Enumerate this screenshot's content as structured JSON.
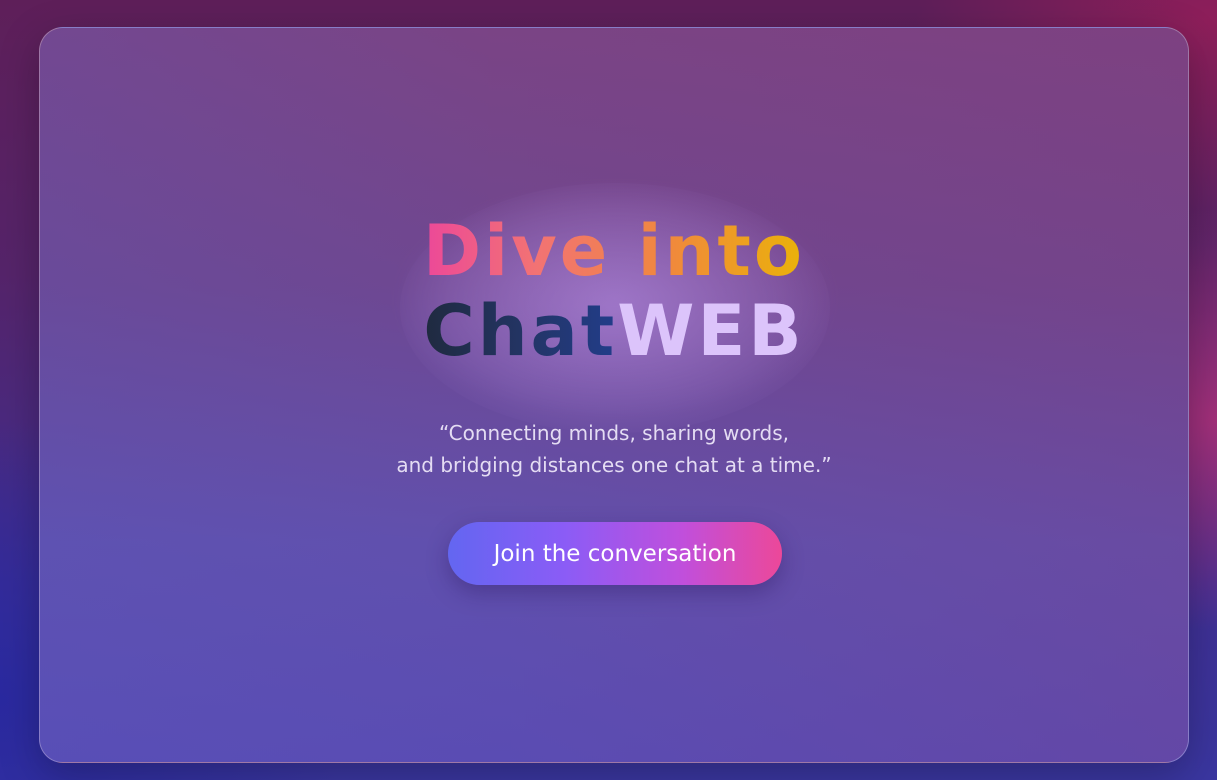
{
  "hero": {
    "title_line1": "Dive into",
    "title_chat": "Chat",
    "title_web": "WEB",
    "quote_line1": "“Connecting minds, sharing words,",
    "quote_line2": "and bridging distances one chat at a time.”",
    "cta_label": "Join the conversation"
  },
  "colors": {
    "title_gradient": [
      "#ec4899",
      "#f27373",
      "#f0893c",
      "#eab308"
    ],
    "chat_gradient": [
      "#1f2a3f",
      "#223d8a"
    ],
    "web": "#dcc4fb",
    "button_gradient": [
      "#6366f1",
      "#8b5cf6",
      "#c04fdc",
      "#ec4899"
    ]
  }
}
